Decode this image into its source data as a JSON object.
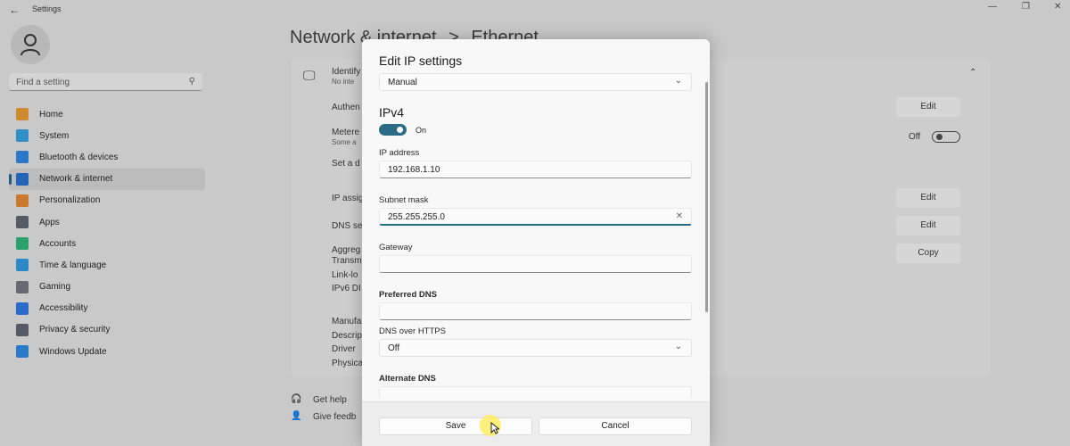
{
  "window": {
    "title": "Settings",
    "back_glyph": "←",
    "minimize": "—",
    "maximize": "❐",
    "close": "✕"
  },
  "search": {
    "placeholder": "Find a setting",
    "icon": "search-icon"
  },
  "sidebar": {
    "items": [
      {
        "label": "Home",
        "icon": "home-icon",
        "color": "#d08a2c"
      },
      {
        "label": "System",
        "icon": "system-icon",
        "color": "#2f8fc8"
      },
      {
        "label": "Bluetooth & devices",
        "icon": "bluetooth-icon",
        "color": "#2a78c8"
      },
      {
        "label": "Network & internet",
        "icon": "wifi-icon",
        "color": "#2563b8",
        "active": true
      },
      {
        "label": "Personalization",
        "icon": "brush-icon",
        "color": "#c87a2a"
      },
      {
        "label": "Apps",
        "icon": "apps-icon",
        "color": "#555a66"
      },
      {
        "label": "Accounts",
        "icon": "accounts-icon",
        "color": "#2aa06a"
      },
      {
        "label": "Time & language",
        "icon": "globe-icon",
        "color": "#2a8ac8"
      },
      {
        "label": "Gaming",
        "icon": "gaming-icon",
        "color": "#666a70"
      },
      {
        "label": "Accessibility",
        "icon": "accessibility-icon",
        "color": "#2a6ac8"
      },
      {
        "label": "Privacy & security",
        "icon": "shield-icon",
        "color": "#555a66"
      },
      {
        "label": "Windows Update",
        "icon": "update-icon",
        "color": "#2a7ac8"
      }
    ]
  },
  "breadcrumb": {
    "parent": "Network & internet",
    "separator": ">",
    "current": "Ethernet"
  },
  "background": {
    "identify": "Identify",
    "no_internet": "No inte",
    "authentication": "Authen",
    "metered": "Metere",
    "some": "Some a",
    "set_data": "Set a d",
    "ip_assign": "IP assig",
    "dns_server": "DNS se",
    "aggregated": "Aggreg",
    "transmit": "Transm",
    "link_local": "Link-lo",
    "ipv6_dns": "IPv6 DI",
    "manufacturer": "Manufa",
    "description": "Descrip",
    "driver": "Driver",
    "physical": "Physica",
    "edit1": "Edit",
    "edit2": "Edit",
    "edit3": "Edit",
    "copy": "Copy",
    "off": "Off",
    "collapse_glyph": "⌃",
    "get_help": "Get help",
    "give_feedback": "Give feedb"
  },
  "dialog": {
    "title": "Edit IP settings",
    "mode": "Manual",
    "section": "IPv4",
    "toggle_label": "On",
    "ip_address_label": "IP address",
    "ip_address_value": "192.168.1.10",
    "subnet_label": "Subnet mask",
    "subnet_value": "255.255.255.0",
    "gateway_label": "Gateway",
    "gateway_value": "",
    "preferred_dns_label": "Preferred DNS",
    "preferred_dns_value": "",
    "dns_https_label": "DNS over HTTPS",
    "dns_https_value": "Off",
    "alternate_dns_label": "Alternate DNS",
    "save": "Save",
    "cancel": "Cancel",
    "chevron": "⌄",
    "clear": "✕"
  }
}
